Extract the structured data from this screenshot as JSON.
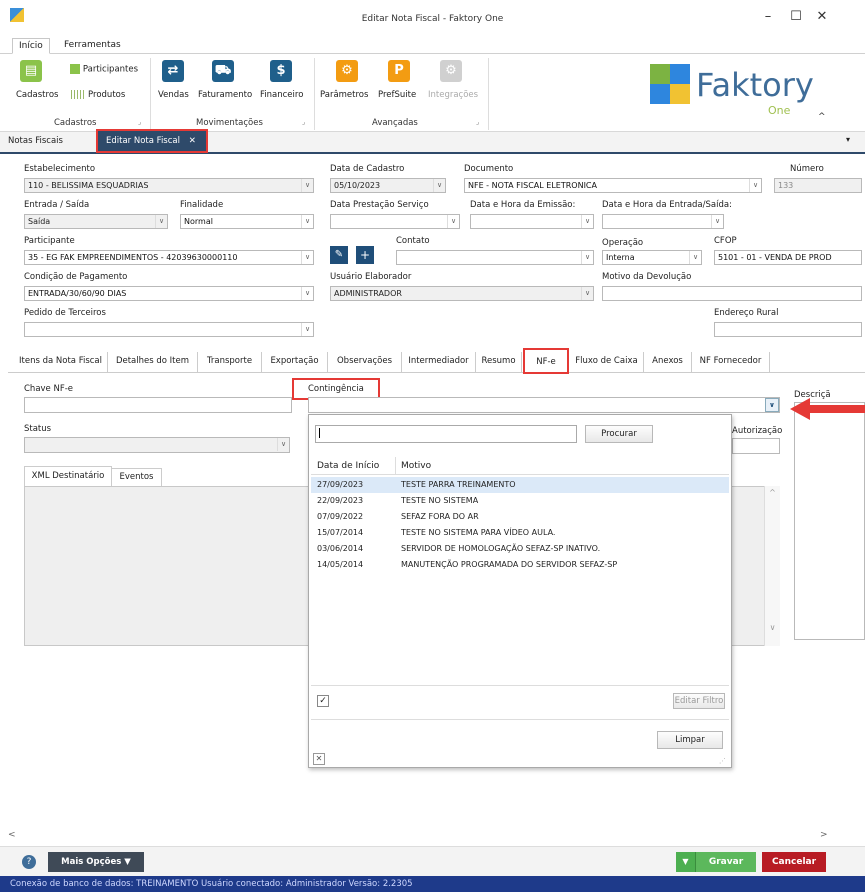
{
  "window": {
    "title": "Editar Nota Fiscal - Faktory One"
  },
  "ribbon_tabs": [
    "Início",
    "Ferramentas"
  ],
  "ribbon": {
    "cadastros": {
      "participantes": "Participantes",
      "cadastros": "Cadastros",
      "produtos": "Produtos",
      "group": "Cadastros"
    },
    "movimentacoes": {
      "vendas": "Vendas",
      "faturamento": "Faturamento",
      "financeiro": "Financeiro",
      "group": "Movimentações"
    },
    "avancadas": {
      "parametros": "Parâmetros",
      "prefsuite": "PrefSuite",
      "integracoes": "Integrações",
      "group": "Avançadas"
    }
  },
  "logo": {
    "name": "Faktory",
    "sub": "One"
  },
  "doc_tabs": {
    "notas": "Notas Fiscais",
    "editar": "Editar Nota Fiscal"
  },
  "form": {
    "estabelecimento": {
      "label": "Estabelecimento",
      "value": "110 - BELISSIMA ESQUADRIAS"
    },
    "data_cadastro": {
      "label": "Data de Cadastro",
      "value": "05/10/2023"
    },
    "documento": {
      "label": "Documento",
      "value": "NFE - NOTA FISCAL ELETRONICA"
    },
    "numero": {
      "label": "Número",
      "value": "133"
    },
    "entrada_saida": {
      "label": "Entrada / Saída",
      "value": "Saída"
    },
    "finalidade": {
      "label": "Finalidade",
      "value": "Normal"
    },
    "data_prestacao": {
      "label": "Data Prestação Serviço",
      "value": ""
    },
    "data_emissao": {
      "label": "Data e Hora da Emissão:",
      "value": ""
    },
    "data_entrada_saida": {
      "label": "Data e Hora da Entrada/Saída:",
      "value": ""
    },
    "participante": {
      "label": "Participante",
      "value": "35 - EG FAK EMPREENDIMENTOS - 42039630000110"
    },
    "contato": {
      "label": "Contato",
      "value": ""
    },
    "operacao": {
      "label": "Operação",
      "value": "Interna"
    },
    "cfop": {
      "label": "CFOP",
      "value": "5101 - 01 - VENDA DE PROD"
    },
    "condicao_pagamento": {
      "label": "Condição de Pagamento",
      "value": "ENTRADA/30/60/90 DIAS"
    },
    "usuario_elaborador": {
      "label": "Usuário Elaborador",
      "value": "ADMINISTRADOR"
    },
    "motivo_devolucao": {
      "label": "Motivo da Devolução",
      "value": ""
    },
    "pedido_terceiros": {
      "label": "Pedido de Terceiros",
      "value": ""
    },
    "endereco_rural": {
      "label": "Endereço Rural",
      "value": ""
    }
  },
  "tabs": [
    "Itens da Nota Fiscal",
    "Detalhes do Item",
    "Transporte",
    "Exportação",
    "Observações",
    "Intermediador",
    "Resumo",
    "NF-e",
    "Fluxo de Caixa",
    "Anexos",
    "NF Fornecedor"
  ],
  "nfe": {
    "chave_label": "Chave NF-e",
    "contingencia_label": "Contingência",
    "descricao_label": "Descriçã",
    "status_label": "Status",
    "autorizacao_label": "Autorização",
    "subtabs": [
      "XML Destinatário",
      "Eventos"
    ]
  },
  "popup": {
    "search_value": "",
    "search_button": "Procurar",
    "columns": [
      "Data de Início",
      "Motivo"
    ],
    "rows": [
      {
        "data": "27/09/2023",
        "motivo": "TESTE PARRA TREINAMENTO"
      },
      {
        "data": "22/09/2023",
        "motivo": "TESTE NO SISTEMA"
      },
      {
        "data": "07/09/2022",
        "motivo": "SEFAZ FORA DO AR"
      },
      {
        "data": "15/07/2014",
        "motivo": "TESTE NO SISTEMA PARA VÍDEO AULA."
      },
      {
        "data": "03/06/2014",
        "motivo": "SERVIDOR DE HOMOLOGAÇÃO SEFAZ-SP INATIVO."
      },
      {
        "data": "14/05/2014",
        "motivo": "MANUTENÇÃO PROGRAMADA DO SERVIDOR SEFAZ-SP"
      }
    ],
    "editar_filtro": "Editar Filtro",
    "limpar": "Limpar"
  },
  "bottom": {
    "mais_opcoes": "Mais Opções",
    "gravar": "Gravar",
    "cancelar": "Cancelar"
  },
  "status_bar": "Conexão de banco de dados: TREINAMENTO   Usuário conectado: Administrador   Versão: 2.2305",
  "colors": {
    "accent": "#1e3a8a",
    "gravar": "#5cb85c",
    "cancelar": "#b81c24",
    "highlight": "#e53935"
  }
}
